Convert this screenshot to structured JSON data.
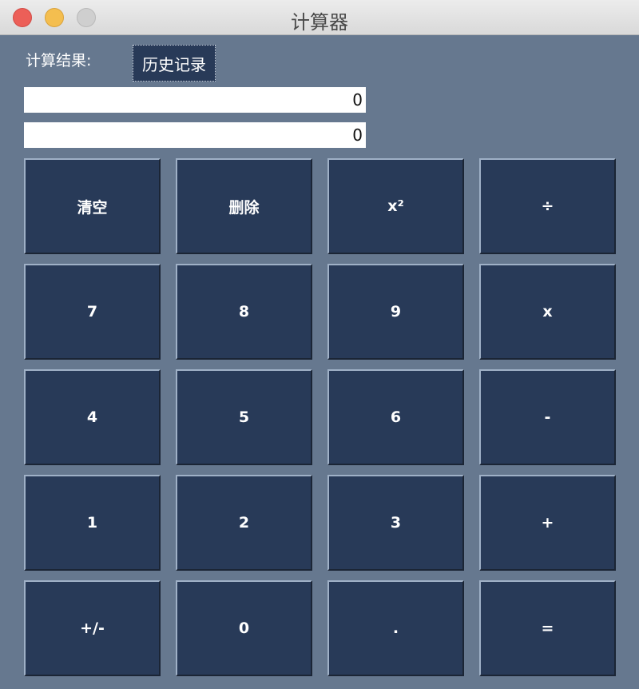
{
  "window": {
    "title": "计算器"
  },
  "header": {
    "result_label": "计算结果:",
    "history_button": "历史记录"
  },
  "displays": {
    "expression": "0",
    "result": "0"
  },
  "keypad": {
    "keys": [
      {
        "label": "清空"
      },
      {
        "label": "删除"
      },
      {
        "label": "x²"
      },
      {
        "label": "÷"
      },
      {
        "label": "7"
      },
      {
        "label": "8"
      },
      {
        "label": "9"
      },
      {
        "label": "x"
      },
      {
        "label": "4"
      },
      {
        "label": "5"
      },
      {
        "label": "6"
      },
      {
        "label": "-"
      },
      {
        "label": "1"
      },
      {
        "label": "2"
      },
      {
        "label": "3"
      },
      {
        "label": "+"
      },
      {
        "label": "+/-"
      },
      {
        "label": "0"
      },
      {
        "label": "."
      },
      {
        "label": "="
      }
    ]
  },
  "colors": {
    "background": "#66788f",
    "key": "#283a58",
    "close": "#ec5f58",
    "minimize": "#f4be4f",
    "zoom": "#cfcfcf"
  }
}
